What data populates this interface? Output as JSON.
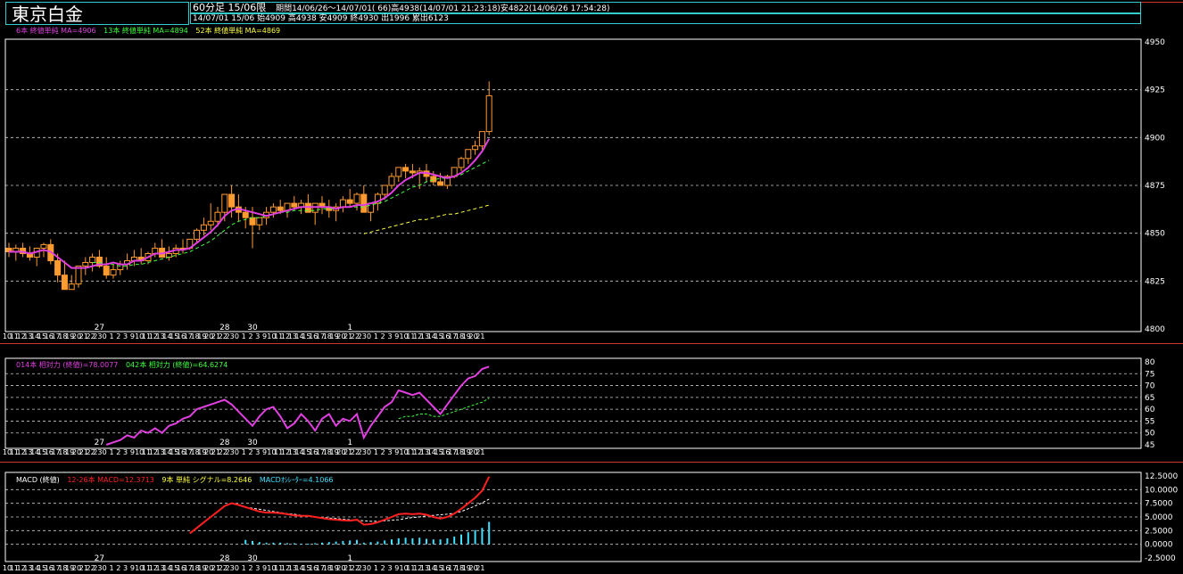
{
  "header": {
    "title": "東京白金",
    "info_prefix": "60分足 15/06限",
    "info_period": "期間14/06/26〜14/07/01( 66)高4938(14/07/01 21:23:18)安4822(14/06/26 17:54:28)",
    "info_last": "14/07/01 15/06 始4909 高4938 安4909 終4930 出1996 累出6123"
  },
  "colors": {
    "up": "#000000",
    "down": "#ff9b2f",
    "ma6": "#e040e0",
    "ma13": "#40ff40",
    "ma52": "#ffff40",
    "rsi14": "#e040e0",
    "rsi42": "#40ff40",
    "macd": "#ff2020",
    "signal": "#ffffff",
    "osc": "#40e0ff",
    "axis": "#ffffff"
  },
  "legends": {
    "price": [
      "6本 終値単純 MA=4906",
      "13本 終値単純 MA=4894",
      "52本 終値単純 MA=4869"
    ],
    "rsi": [
      "014本 相対力 (終値)=78.0077",
      "042本 相対力 (終値)=64.6274"
    ],
    "macd_title": "MACD (終値)",
    "macd": [
      "12-26本 MACD=12.3713",
      "9本 単純 シグナル=8.2646",
      "MACDｵｼﾚｰﾀｰ=4.1066"
    ]
  },
  "x_hours": [
    "10",
    "11",
    "12",
    "13",
    "14",
    "15",
    "16",
    "17",
    "18",
    "19",
    "20",
    "21",
    "22",
    "23",
    "0",
    "1",
    "2",
    "3",
    "9",
    "10",
    "11",
    "12",
    "13",
    "14",
    "15",
    "16",
    "17",
    "18",
    "19",
    "20",
    "21",
    "22",
    "23",
    "0",
    "1",
    "2",
    "3",
    "9",
    "10",
    "11",
    "12",
    "13",
    "14",
    "15",
    "16",
    "17",
    "18",
    "19",
    "20",
    "21",
    "22",
    "23",
    "0",
    "1",
    "2",
    "3",
    "9",
    "10",
    "11",
    "12",
    "13",
    "14",
    "15",
    "16",
    "17",
    "18",
    "19",
    "20",
    "21"
  ],
  "x_days": [
    {
      "label": "27",
      "index": 13
    },
    {
      "label": "28",
      "index": 31
    },
    {
      "label": "30",
      "index": 35
    },
    {
      "label": "1",
      "index": 49
    }
  ],
  "chart_data": [
    {
      "type": "candlestick",
      "ylim": [
        4800,
        4960
      ],
      "yticks": [
        "4950",
        "4925",
        "4900",
        "4875",
        "4850",
        "4825",
        "4800"
      ],
      "grid": "horizontal dashed",
      "open": [
        4845,
        4843,
        4845,
        4842,
        4840,
        4845,
        4847,
        4838,
        4830,
        4822,
        4825,
        4835,
        4837,
        4840,
        4835,
        4830,
        4833,
        4836,
        4838,
        4840,
        4838,
        4842,
        4845,
        4840,
        4842,
        4845,
        4845,
        4850,
        4855,
        4858,
        4860,
        4865,
        4875,
        4868,
        4865,
        4862,
        4858,
        4862,
        4865,
        4868,
        4866,
        4870,
        4868,
        4870,
        4865,
        4870,
        4868,
        4866,
        4868,
        4872,
        4870,
        4875,
        4865,
        4870,
        4875,
        4880,
        4885,
        4890,
        4888,
        4887,
        4888,
        4885,
        4882,
        4880,
        4885,
        4890,
        4895,
        4900,
        4902,
        4910
      ],
      "high": [
        4848,
        4847,
        4848,
        4846,
        4844,
        4848,
        4850,
        4842,
        4838,
        4830,
        4832,
        4840,
        4842,
        4844,
        4840,
        4836,
        4838,
        4842,
        4844,
        4845,
        4843,
        4848,
        4850,
        4846,
        4847,
        4850,
        4850,
        4856,
        4862,
        4870,
        4868,
        4875,
        4880,
        4875,
        4868,
        4868,
        4862,
        4868,
        4870,
        4872,
        4870,
        4874,
        4872,
        4875,
        4870,
        4874,
        4872,
        4870,
        4874,
        4878,
        4876,
        4880,
        4870,
        4876,
        4880,
        4887,
        4890,
        4892,
        4892,
        4890,
        4892,
        4888,
        4887,
        4886,
        4890,
        4896,
        4900,
        4905,
        4908,
        4938
      ],
      "low": [
        4840,
        4838,
        4840,
        4838,
        4835,
        4840,
        4836,
        4826,
        4822,
        4822,
        4823,
        4830,
        4832,
        4834,
        4828,
        4828,
        4830,
        4833,
        4835,
        4836,
        4836,
        4840,
        4841,
        4838,
        4840,
        4842,
        4844,
        4848,
        4852,
        4855,
        4857,
        4860,
        4862,
        4860,
        4856,
        4845,
        4855,
        4858,
        4862,
        4864,
        4862,
        4866,
        4864,
        4865,
        4858,
        4864,
        4862,
        4860,
        4865,
        4868,
        4866,
        4870,
        4860,
        4866,
        4872,
        4878,
        4882,
        4884,
        4884,
        4878,
        4882,
        4880,
        4880,
        4878,
        4884,
        4888,
        4892,
        4897,
        4900,
        4908
      ],
      "close": [
        4843,
        4845,
        4842,
        4840,
        4845,
        4847,
        4838,
        4830,
        4822,
        4825,
        4835,
        4837,
        4840,
        4835,
        4830,
        4833,
        4836,
        4838,
        4840,
        4838,
        4842,
        4845,
        4840,
        4842,
        4845,
        4845,
        4850,
        4855,
        4858,
        4860,
        4865,
        4875,
        4868,
        4865,
        4862,
        4858,
        4862,
        4865,
        4868,
        4866,
        4870,
        4868,
        4870,
        4865,
        4870,
        4868,
        4866,
        4868,
        4872,
        4870,
        4875,
        4865,
        4870,
        4875,
        4880,
        4885,
        4890,
        4888,
        4887,
        4888,
        4885,
        4882,
        4880,
        4885,
        4890,
        4895,
        4900,
        4902,
        4910,
        4930
      ],
      "ma6": [
        4843,
        4843,
        4843,
        4842,
        4843,
        4844,
        4843,
        4840,
        4837,
        4834,
        4834,
        4834,
        4835,
        4836,
        4836,
        4837,
        4836,
        4836,
        4838,
        4838,
        4840,
        4842,
        4842,
        4843,
        4844,
        4844,
        4845,
        4848,
        4851,
        4854,
        4858,
        4863,
        4866,
        4867,
        4866,
        4865,
        4864,
        4863,
        4864,
        4865,
        4866,
        4867,
        4868,
        4868,
        4868,
        4868,
        4868,
        4867,
        4868,
        4868,
        4869,
        4869,
        4870,
        4871,
        4873,
        4876,
        4880,
        4883,
        4885,
        4887,
        4887,
        4886,
        4885,
        4884,
        4885,
        4887,
        4890,
        4894,
        4899,
        4906
      ],
      "ma13": [
        null,
        null,
        null,
        null,
        null,
        null,
        null,
        null,
        null,
        null,
        null,
        null,
        4837,
        4837,
        4836,
        4836,
        4835,
        4835,
        4836,
        4836,
        4837,
        4838,
        4839,
        4840,
        4841,
        4842,
        4843,
        4845,
        4847,
        4849,
        4852,
        4855,
        4858,
        4860,
        4861,
        4862,
        4862,
        4863,
        4864,
        4865,
        4865,
        4866,
        4866,
        4866,
        4866,
        4867,
        4867,
        4867,
        4868,
        4868,
        4868,
        4868,
        4869,
        4870,
        4871,
        4873,
        4875,
        4877,
        4879,
        4880,
        4882,
        4883,
        4884,
        4884,
        4885,
        4886,
        4888,
        4890,
        4892,
        4894
      ],
      "ma52": [
        null,
        null,
        null,
        null,
        null,
        null,
        null,
        null,
        null,
        null,
        null,
        null,
        null,
        null,
        null,
        null,
        null,
        null,
        null,
        null,
        null,
        null,
        null,
        null,
        null,
        null,
        null,
        null,
        null,
        null,
        null,
        null,
        null,
        null,
        null,
        null,
        null,
        null,
        null,
        null,
        null,
        null,
        null,
        null,
        null,
        null,
        null,
        null,
        null,
        null,
        null,
        4853,
        4854,
        4855,
        4856,
        4857,
        4858,
        4859,
        4860,
        4861,
        4861,
        4862,
        4863,
        4864,
        4864,
        4865,
        4866,
        4867,
        4868,
        4869
      ]
    },
    {
      "type": "line",
      "ylim": [
        45,
        80
      ],
      "yticks": [
        "80",
        "75",
        "70",
        "65",
        "60",
        "55",
        "50",
        "45"
      ],
      "rsi14": [
        null,
        null,
        null,
        null,
        null,
        null,
        null,
        null,
        null,
        null,
        null,
        null,
        null,
        null,
        45,
        46,
        47,
        49,
        48,
        51,
        50,
        52,
        50,
        53,
        54,
        56,
        57,
        60,
        61,
        62,
        63,
        64,
        62,
        59,
        56,
        53,
        57,
        60,
        61,
        57,
        52,
        54,
        58,
        55,
        51,
        56,
        58,
        53,
        56,
        55,
        58,
        48,
        53,
        57,
        61,
        63,
        68,
        67,
        66,
        67,
        64,
        61,
        58,
        62,
        66,
        70,
        73,
        74,
        77,
        78
      ],
      "rsi42": [
        null,
        null,
        null,
        null,
        null,
        null,
        null,
        null,
        null,
        null,
        null,
        null,
        null,
        null,
        null,
        null,
        null,
        null,
        null,
        null,
        null,
        null,
        null,
        null,
        null,
        null,
        null,
        null,
        null,
        null,
        null,
        null,
        null,
        null,
        null,
        null,
        null,
        null,
        null,
        null,
        null,
        null,
        null,
        null,
        null,
        null,
        null,
        null,
        null,
        null,
        null,
        null,
        null,
        null,
        null,
        null,
        56,
        57,
        57,
        58,
        58,
        57,
        57,
        58,
        59,
        60,
        61,
        62,
        63,
        64.6
      ]
    },
    {
      "type": "line+bar",
      "ylim": [
        -2.5,
        12.5
      ],
      "yticks": [
        "12.5000",
        "10.0000",
        "7.5000",
        "5.0000",
        "2.5000",
        "0.0000",
        "-2.5000"
      ],
      "macd": [
        null,
        null,
        null,
        null,
        null,
        null,
        null,
        null,
        null,
        null,
        null,
        null,
        null,
        null,
        null,
        null,
        null,
        null,
        null,
        null,
        null,
        null,
        null,
        null,
        null,
        null,
        2.0,
        3.0,
        4.0,
        5.0,
        6.0,
        7.0,
        7.5,
        7.2,
        6.8,
        6.4,
        6.0,
        5.8,
        5.8,
        5.7,
        5.5,
        5.3,
        5.2,
        5.2,
        5.0,
        4.8,
        4.6,
        4.5,
        4.4,
        4.3,
        4.5,
        3.6,
        3.7,
        4.0,
        4.5,
        5.0,
        5.5,
        5.6,
        5.5,
        5.6,
        5.4,
        5.0,
        4.7,
        5.0,
        5.6,
        6.5,
        7.5,
        8.5,
        9.8,
        12.37
      ],
      "signal": [
        null,
        null,
        null,
        null,
        null,
        null,
        null,
        null,
        null,
        null,
        null,
        null,
        null,
        null,
        null,
        null,
        null,
        null,
        null,
        null,
        null,
        null,
        null,
        null,
        null,
        null,
        null,
        null,
        null,
        null,
        null,
        null,
        null,
        null,
        6.8,
        6.6,
        6.4,
        6.2,
        6.0,
        5.8,
        5.6,
        5.5,
        5.3,
        5.2,
        5.0,
        4.9,
        4.8,
        4.7,
        4.6,
        4.5,
        4.4,
        4.3,
        4.2,
        4.2,
        4.3,
        4.4,
        4.5,
        4.7,
        4.9,
        5.0,
        5.2,
        5.3,
        5.4,
        5.5,
        5.7,
        6.0,
        6.5,
        7.0,
        7.6,
        8.26
      ],
      "osc": [
        null,
        null,
        null,
        null,
        null,
        null,
        null,
        null,
        null,
        null,
        null,
        null,
        null,
        null,
        null,
        null,
        null,
        null,
        null,
        null,
        null,
        null,
        null,
        null,
        null,
        null,
        null,
        null,
        null,
        null,
        null,
        null,
        null,
        null,
        0.8,
        0.6,
        0.4,
        0.3,
        0.3,
        0.3,
        0.2,
        0.2,
        0.1,
        0.1,
        0.2,
        0.3,
        0.4,
        0.5,
        0.6,
        0.7,
        0.8,
        0.3,
        0.4,
        0.5,
        0.7,
        0.9,
        1.1,
        1.2,
        1.1,
        1.2,
        1.0,
        0.9,
        0.9,
        1.1,
        1.4,
        1.8,
        2.2,
        2.6,
        3.0,
        4.1
      ]
    }
  ]
}
